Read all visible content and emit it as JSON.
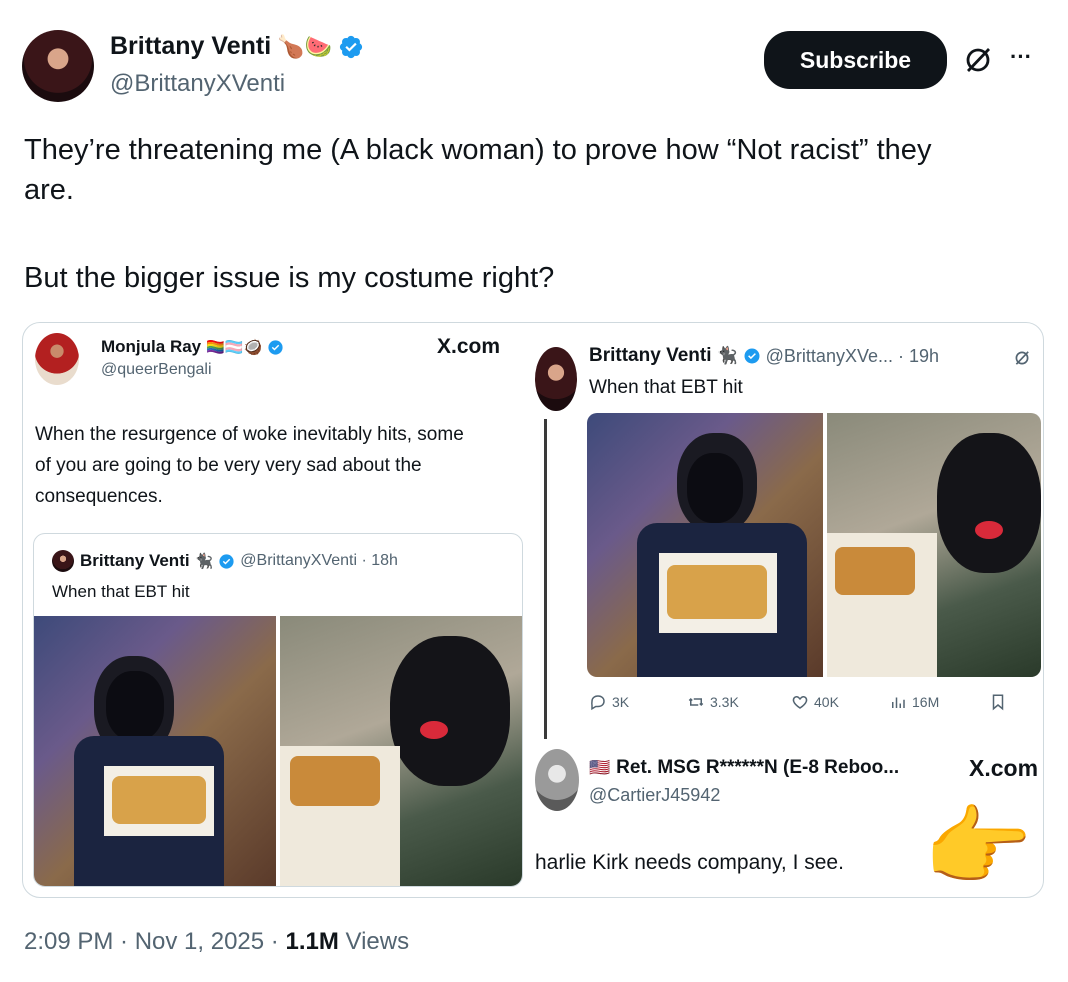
{
  "tweet": {
    "author_name": "Brittany Venti",
    "author_emojis": "🍗🍉",
    "author_handle": "@BrittanyXVenti",
    "subscribe_label": "Subscribe",
    "more_label": "···",
    "text_line1": "They’re threatening me (A black woman) to prove how “Not racist” they",
    "text_line2": "are.",
    "text_line3": "But the bigger issue is my costume right?",
    "footer_time": "2:09 PM · Nov 1, 2025 · ",
    "footer_views_count": "1.1M",
    "footer_views_label": " Views"
  },
  "media": {
    "left_card": {
      "author_name": "Monjula Ray",
      "author_emojis": "🏳️‍🌈🏳️‍⚧️🥥",
      "author_handle": "@queerBengali",
      "source_logo": "X.com",
      "text_line1": "When the resurgence of woke inevitably hits, some",
      "text_line2": "of you are going to be very very sad about the",
      "text_line3": "consequences.",
      "quote": {
        "author_name": "Brittany Venti",
        "author_emoji": "🐈‍⬛",
        "handle_time": "@BrittanyXVenti · 18h",
        "text": "When that EBT hit"
      }
    },
    "right_card": {
      "author_name": "Brittany Venti",
      "author_emoji": "🐈‍⬛",
      "handle_time": "@BrittanyXVe... · 19h",
      "text": "When that EBT hit",
      "stats": {
        "replies": "3K",
        "reposts": "3.3K",
        "likes": "40K",
        "views": "16M"
      },
      "reply": {
        "flag": "🇺🇸",
        "author_name": "Ret. MSG R******N (E-8 Reboo...",
        "author_handle": "@CartierJ45942",
        "source_logo": "X.com",
        "text": "harlie Kirk needs company, I see.",
        "emoji": "👉"
      }
    }
  },
  "colors": {
    "verified": "#1d9bf0",
    "text": "#0f1419",
    "secondary": "#536471",
    "border": "#cfd9de"
  }
}
